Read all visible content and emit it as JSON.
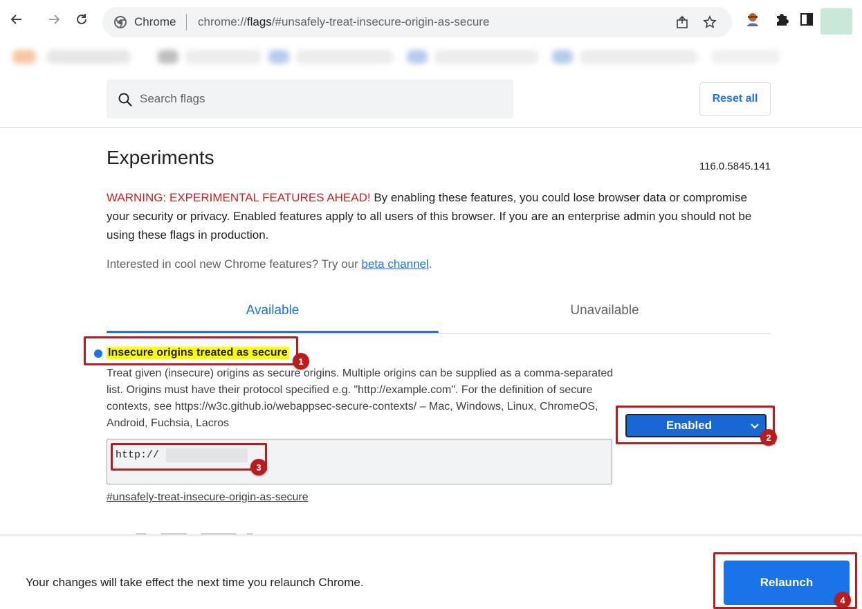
{
  "browser": {
    "site_label": "Chrome",
    "url_prefix": "chrome://",
    "url_host": "flags",
    "url_rest": "/#unsafely-treat-insecure-origin-as-secure"
  },
  "flags_page": {
    "search_placeholder": "Search flags",
    "reset_label": "Reset all",
    "title": "Experiments",
    "version": "116.0.5845.141",
    "warning_strong": "WARNING: EXPERIMENTAL FEATURES AHEAD!",
    "warning_text": " By enabling these features, you could lose browser data or compromise your security or privacy. Enabled features apply to all users of this browser. If you are an enterprise admin you should not be using these flags in production.",
    "promo_text": "Interested in cool new Chrome features? Try our ",
    "promo_link": "beta channel",
    "promo_end": ".",
    "tabs": [
      {
        "label": "Available",
        "selected": true
      },
      {
        "label": "Unavailable",
        "selected": false
      }
    ]
  },
  "flag": {
    "title": "Insecure origins treated as secure",
    "description": "Treat given (insecure) origins as secure origins. Multiple origins can be supplied as a comma-separated list. Origins must have their protocol specified e.g. \"http://example.com\". For the definition of secure contexts, see https://w3c.github.io/webappsec-secure-contexts/ – Mac, Windows, Linux, ChromeOS, Android, Fuchsia, Lacros",
    "value": "http://",
    "anchor": "#unsafely-treat-insecure-origin-as-secure",
    "state": "Enabled"
  },
  "relaunch": {
    "message": "Your changes will take effect the next time you relaunch Chrome.",
    "button_label": "Relaunch"
  },
  "annotations": [
    "1",
    "2",
    "3",
    "4"
  ],
  "colors": {
    "accent": "#1a73e8",
    "annotation_red": "#b91c1c",
    "highlight": "#ffff00",
    "warning": "#c5221f"
  }
}
